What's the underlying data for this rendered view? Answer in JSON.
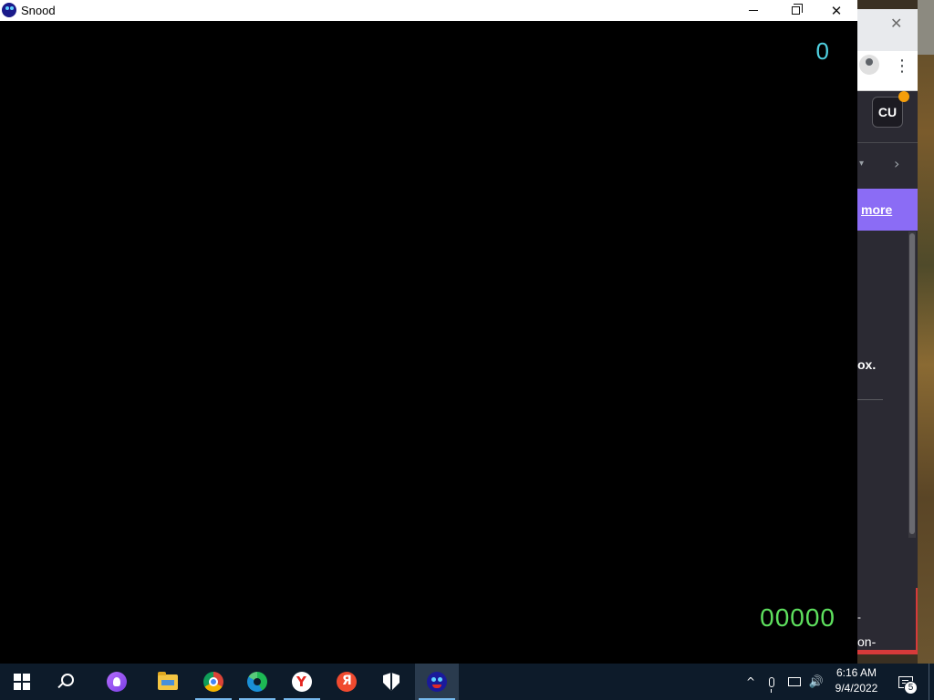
{
  "window": {
    "title": "Snood",
    "minimize_glyph": "",
    "close_glyph": "✕"
  },
  "game": {
    "score_top": "0",
    "score_bottom": "00000",
    "score_top_color": "#4fd0e0",
    "score_bottom_color": "#5ee05e"
  },
  "background_browser": {
    "close_glyph": "✕",
    "kebab_glyph": "⋮",
    "avatar_text": "CU",
    "dropdown_glyph": "▾",
    "chevron_glyph": "›",
    "banner_link": "more",
    "partial_text_1": "ox.",
    "partial_text_2": "-",
    "partial_text_3": "on-",
    "banner_color": "#8b6cf5"
  },
  "taskbar": {
    "items": [
      {
        "name": "start-button",
        "icon": "windows-icon"
      },
      {
        "name": "search-button",
        "icon": "search-icon"
      },
      {
        "name": "alice-assistant",
        "icon": "alice-icon"
      },
      {
        "name": "file-explorer",
        "icon": "folder-icon"
      },
      {
        "name": "chrome",
        "icon": "chrome-icon"
      },
      {
        "name": "edge",
        "icon": "edge-icon"
      },
      {
        "name": "yandex",
        "icon": "yandex-icon"
      },
      {
        "name": "yandex-browser",
        "icon": "yandex-browser-icon"
      },
      {
        "name": "windows-security",
        "icon": "shield-icon"
      },
      {
        "name": "snood",
        "icon": "snood-icon"
      }
    ],
    "tray": {
      "chevron": "^",
      "volume": "🔊",
      "time": "6:16 AM",
      "date": "9/4/2022",
      "notification_count": "5"
    },
    "background_color": "#0d1b2a"
  }
}
